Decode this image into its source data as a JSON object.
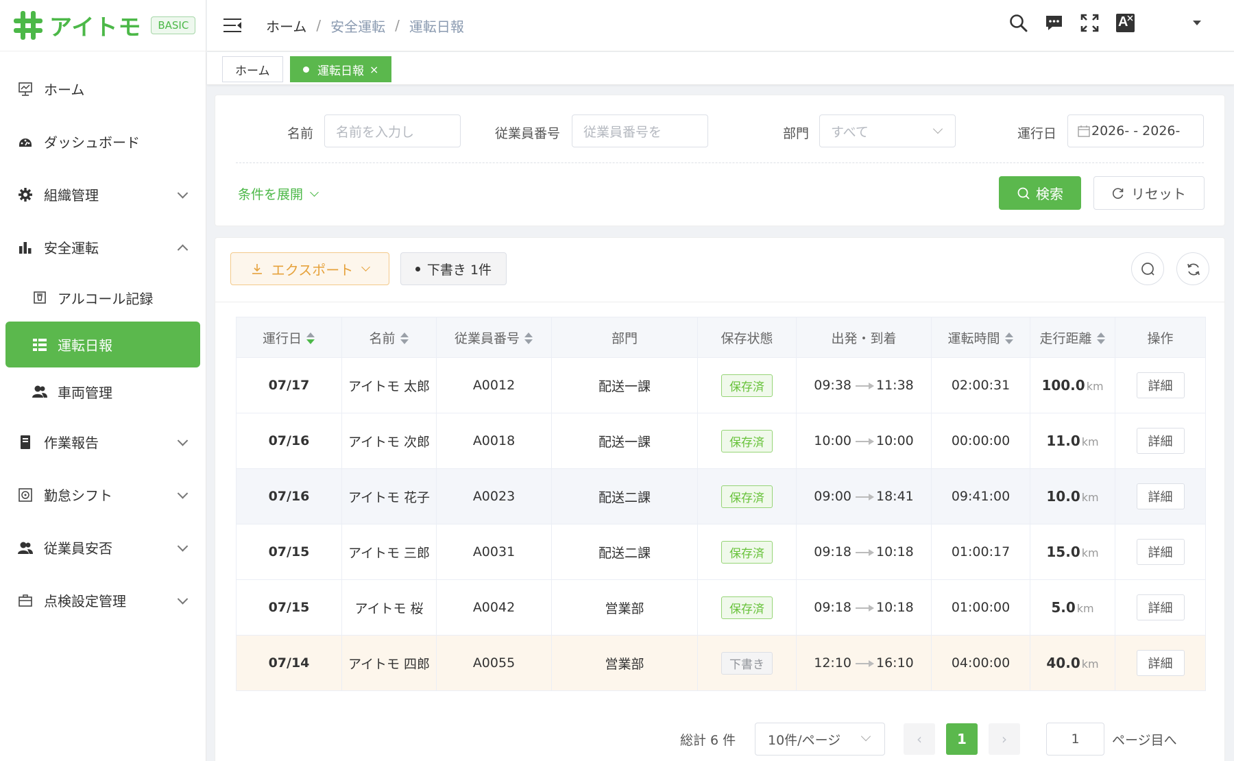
{
  "app": {
    "name": "アイトモ",
    "plan": "BASIC"
  },
  "sidebar": {
    "items": [
      {
        "label": "ホーム"
      },
      {
        "label": "ダッシュボード"
      },
      {
        "label": "組織管理"
      },
      {
        "label": "安全運転"
      },
      {
        "label": "アルコール記録"
      },
      {
        "label": "運転日報"
      },
      {
        "label": "車両管理"
      },
      {
        "label": "作業報告"
      },
      {
        "label": "勤怠シフト"
      },
      {
        "label": "従業員安否"
      },
      {
        "label": "点検設定管理"
      }
    ]
  },
  "header": {
    "breadcrumb": [
      "ホーム",
      "安全運転",
      "運転日報"
    ],
    "lang_icon_text": "A"
  },
  "tags": [
    {
      "label": "ホーム"
    },
    {
      "label": "運転日報",
      "close": "×"
    }
  ],
  "search": {
    "name_label": "名前",
    "name_placeholder": "名前を入力し",
    "emp_label": "従業員番号",
    "emp_placeholder": "従業員番号を",
    "dept_label": "部門",
    "dept_value": "すべて",
    "date_label": "運行日",
    "date_value": "2026- - 2026-",
    "expand_label": "条件を展開",
    "search_button": "検索",
    "reset_button": "リセット"
  },
  "toolbar": {
    "export_label": "エクスポート",
    "draft_label": "下書き 1件"
  },
  "table": {
    "columns": [
      "運行日",
      "名前",
      "従業員番号",
      "部門",
      "保存状態",
      "出発・到着",
      "運転時間",
      "走行距離",
      "操作"
    ],
    "unit": "km",
    "rows": [
      {
        "date": "07/17",
        "name": "アイトモ 太郎",
        "emp": "A0012",
        "dept": "配送一課",
        "status": "保存済",
        "depart": "09:38",
        "arrive": "11:38",
        "duration": "02:00:31",
        "distance": "100.0",
        "action": "詳細"
      },
      {
        "date": "07/16",
        "name": "アイトモ 次郎",
        "emp": "A0018",
        "dept": "配送一課",
        "status": "保存済",
        "depart": "10:00",
        "arrive": "10:00",
        "duration": "00:00:00",
        "distance": "11.0",
        "action": "詳細"
      },
      {
        "date": "07/16",
        "name": "アイトモ 花子",
        "emp": "A0023",
        "dept": "配送二課",
        "status": "保存済",
        "depart": "09:00",
        "arrive": "18:41",
        "duration": "09:41:00",
        "distance": "10.0",
        "action": "詳細"
      },
      {
        "date": "07/15",
        "name": "アイトモ 三郎",
        "emp": "A0031",
        "dept": "配送二課",
        "status": "保存済",
        "depart": "09:18",
        "arrive": "10:18",
        "duration": "01:00:17",
        "distance": "15.0",
        "action": "詳細"
      },
      {
        "date": "07/15",
        "name": "アイトモ 桜",
        "emp": "A0042",
        "dept": "営業部",
        "status": "保存済",
        "depart": "09:18",
        "arrive": "10:18",
        "duration": "01:00:00",
        "distance": "5.0",
        "action": "詳細"
      },
      {
        "date": "07/14",
        "name": "アイトモ 四郎",
        "emp": "A0055",
        "dept": "営業部",
        "status": "下書き",
        "depart": "12:10",
        "arrive": "16:10",
        "duration": "04:00:00",
        "distance": "40.0",
        "action": "詳細"
      }
    ]
  },
  "pagination": {
    "total": "総計 6 件",
    "page_size": "10件/ページ",
    "prev": "‹",
    "current": "1",
    "next": "›",
    "jump_value": "1",
    "jump_label": "ページ目へ"
  },
  "colors": {
    "accent": "#5bb84d",
    "warning": "#e6a23c"
  }
}
